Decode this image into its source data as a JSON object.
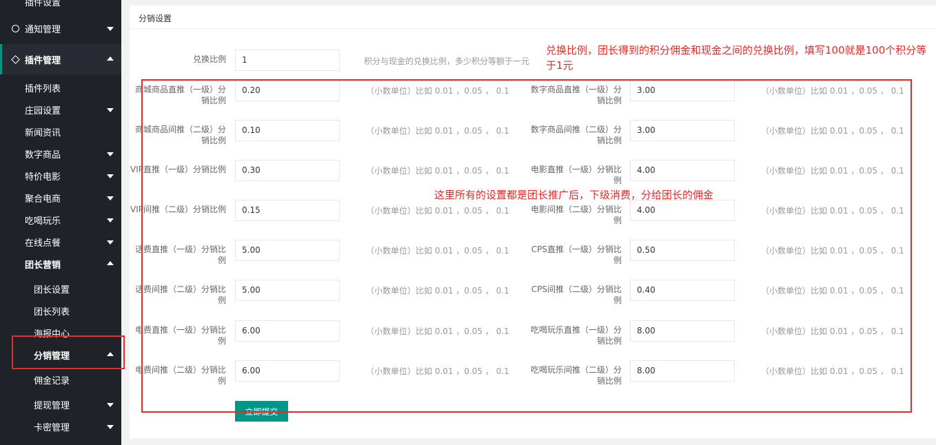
{
  "sidebar": {
    "top_partial": "插件设置",
    "notice": "通知管理",
    "plugin_group": "插件管理",
    "items": [
      {
        "label": "插件列表",
        "caret": ""
      },
      {
        "label": "庄园设置",
        "caret": "down"
      },
      {
        "label": "新闻资讯",
        "caret": ""
      },
      {
        "label": "数字商品",
        "caret": "down"
      },
      {
        "label": "特价电影",
        "caret": "down"
      },
      {
        "label": "聚合电商",
        "caret": "down"
      },
      {
        "label": "吃喝玩乐",
        "caret": "down"
      },
      {
        "label": "在线点餐",
        "caret": "down"
      },
      {
        "label": "团长营销",
        "caret": "up"
      }
    ],
    "sub_items": [
      {
        "label": "团长设置",
        "caret": ""
      },
      {
        "label": "团长列表",
        "caret": ""
      },
      {
        "label": "海报中心",
        "caret": ""
      },
      {
        "label": "分销管理",
        "caret": "up"
      },
      {
        "label": "佣金记录",
        "caret": ""
      },
      {
        "label": "提现管理",
        "caret": "down"
      },
      {
        "label": "卡密管理",
        "caret": "down"
      }
    ]
  },
  "panel": {
    "title": "分销设置",
    "ratio_label": "兑换比例",
    "ratio_value": "1",
    "ratio_hint": "积分与现金的兑换比例，多少积分等额于一元",
    "hint": "（小数单位）比如 0.01 ，0.05 ， 0.1",
    "left_fields": [
      {
        "label": "商城商品直推（一级）分销比例",
        "value": "0.20"
      },
      {
        "label": "商城商品间推（二级）分销比例",
        "value": "0.10"
      },
      {
        "label": "VIP直推（一级）分销比例",
        "value": "0.30"
      },
      {
        "label": "VIP间推（二级）分销比例",
        "value": "0.15"
      },
      {
        "label": "话费直推（一级）分销比例",
        "value": "5.00"
      },
      {
        "label": "话费间推（二级）分销比例",
        "value": "5.00"
      },
      {
        "label": "电费直推（一级）分销比例",
        "value": "6.00"
      },
      {
        "label": "电费间推（二级）分销比例",
        "value": "6.00"
      }
    ],
    "right_fields": [
      {
        "label": "数字商品直推（一级）分销比例",
        "value": "3.00"
      },
      {
        "label": "数字商品间推（二级）分销比例",
        "value": "3.00"
      },
      {
        "label": "电影直推（一级）分销比例",
        "value": "4.00"
      },
      {
        "label": "电影间推（二级）分销比例",
        "value": "4.00"
      },
      {
        "label": "CPS直推（一级）分销比例",
        "value": "0.50"
      },
      {
        "label": "CPS间推（二级）分销比例",
        "value": "0.40"
      },
      {
        "label": "吃喝玩乐直推（一级）分销比例",
        "value": "8.00"
      },
      {
        "label": "吃喝玩乐间推（二级）分销比例",
        "value": "8.00"
      }
    ],
    "submit_label": "立即提交"
  },
  "annotations": {
    "ratio_note": "兑换比例，团长得到的积分佣金和现金之间的兑换比例，填写100就是100个积分等于1元",
    "settings_note": "这里所有的设置都是团长推广后，下级消费，分给团长的佣金"
  },
  "colors": {
    "sidebar_bg": "#20222a",
    "accent": "#009688",
    "annotation_red": "#e52a27"
  }
}
